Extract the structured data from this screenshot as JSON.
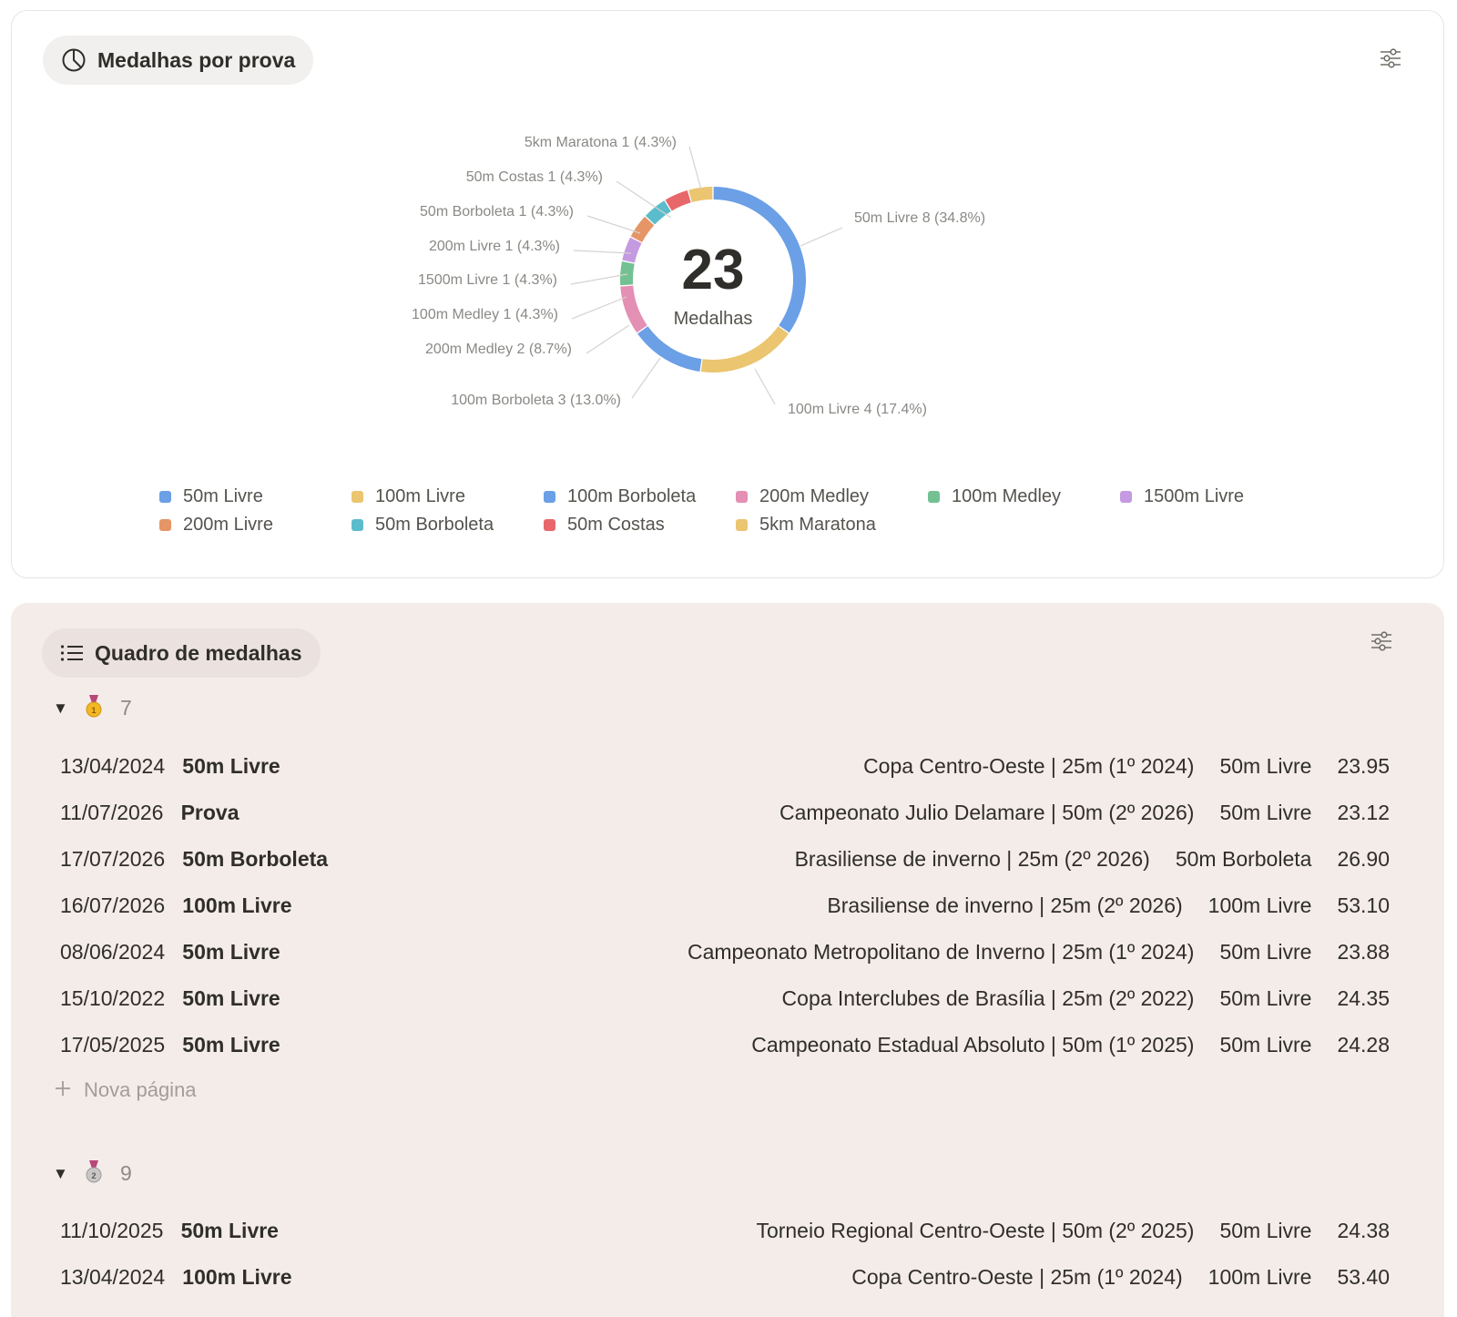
{
  "chart_view": {
    "title": "Medalhas por prova",
    "center_value": "23",
    "center_label": "Medalhas"
  },
  "chart_data": {
    "type": "pie",
    "variant": "donut",
    "total": 23,
    "slices": [
      {
        "label": "50m Livre",
        "value": 8,
        "pct": "34.8%",
        "color": "#6b9fe6"
      },
      {
        "label": "100m Livre",
        "value": 4,
        "pct": "17.4%",
        "color": "#ebc56f"
      },
      {
        "label": "100m Borboleta",
        "value": 3,
        "pct": "13.0%",
        "color": "#6b9fe6"
      },
      {
        "label": "200m Medley",
        "value": 2,
        "pct": "8.7%",
        "color": "#e48fb4"
      },
      {
        "label": "100m Medley",
        "value": 1,
        "pct": "4.3%",
        "color": "#73c192"
      },
      {
        "label": "1500m Livre",
        "value": 1,
        "pct": "4.3%",
        "color": "#c49ae1"
      },
      {
        "label": "200m Livre",
        "value": 1,
        "pct": "4.3%",
        "color": "#e59566"
      },
      {
        "label": "50m Borboleta",
        "value": 1,
        "pct": "4.3%",
        "color": "#5bbccb"
      },
      {
        "label": "50m Costas",
        "value": 1,
        "pct": "4.3%",
        "color": "#e8676a"
      },
      {
        "label": "5km Maratona",
        "value": 1,
        "pct": "4.3%",
        "color": "#ebc56f"
      }
    ],
    "legend": [
      "50m Livre",
      "100m Livre",
      "100m Borboleta",
      "200m Medley",
      "100m Medley",
      "1500m Livre",
      "200m Livre",
      "50m Borboleta",
      "50m Costas",
      "5km Maratona"
    ],
    "legend_placement": "bottom"
  },
  "table_view": {
    "title": "Quadro de medalhas",
    "new_page_label": "Nova página",
    "groups": [
      {
        "count": "7",
        "icon": "gold-medal-icon",
        "rows": [
          {
            "date": "13/04/2024",
            "title": "50m Livre",
            "event": "Copa Centro-Oeste | 25m (1º 2024)",
            "prova": "50m Livre",
            "time": "23.95"
          },
          {
            "date": "11/07/2026",
            "title": "Prova",
            "event": "Campeonato Julio Delamare | 50m (2º 2026)",
            "prova": "50m Livre",
            "time": "23.12"
          },
          {
            "date": "17/07/2026",
            "title": "50m Borboleta",
            "event": "Brasiliense de inverno | 25m (2º 2026)",
            "prova": "50m Borboleta",
            "time": "26.90"
          },
          {
            "date": "16/07/2026",
            "title": "100m Livre",
            "event": "Brasiliense de inverno | 25m (2º 2026)",
            "prova": "100m Livre",
            "time": "53.10"
          },
          {
            "date": "08/06/2024",
            "title": "50m Livre",
            "event": "Campeonato Metropolitano de Inverno | 25m (1º 2024)",
            "prova": "50m Livre",
            "time": "23.88"
          },
          {
            "date": "15/10/2022",
            "title": "50m Livre",
            "event": "Copa Interclubes de Brasília | 25m (2º 2022)",
            "prova": "50m Livre",
            "time": "24.35"
          },
          {
            "date": "17/05/2025",
            "title": "50m Livre",
            "event": "Campeonato Estadual Absoluto | 50m (1º 2025)",
            "prova": "50m Livre",
            "time": "24.28"
          }
        ]
      },
      {
        "count": "9",
        "icon": "silver-medal-icon",
        "rows": [
          {
            "date": "11/10/2025",
            "title": "50m Livre",
            "event": "Torneio Regional Centro-Oeste | 50m (2º 2025)",
            "prova": "50m Livre",
            "time": "24.38"
          },
          {
            "date": "13/04/2024",
            "title": "100m Livre",
            "event": "Copa Centro-Oeste | 25m (1º 2024)",
            "prova": "100m Livre",
            "time": "53.40"
          }
        ]
      }
    ]
  }
}
